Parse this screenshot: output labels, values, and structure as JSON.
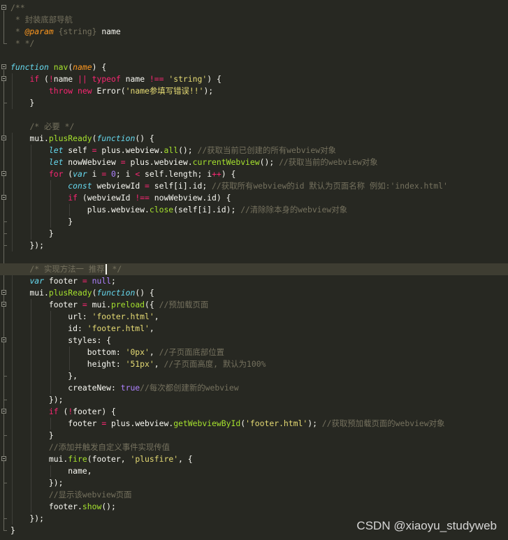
{
  "editor": {
    "theme": "monokai",
    "colors": {
      "background": "#272822",
      "keyword": "#f92672",
      "storage": "#66d9ef",
      "function": "#a6e22e",
      "parameter": "#fd971f",
      "string": "#e6db74",
      "number": "#ae81ff",
      "comment": "#75715e",
      "text": "#f8f8f2"
    },
    "current_line": 23,
    "lines": [
      {
        "fold": true,
        "tokens": [
          [
            "cm",
            "/**"
          ]
        ]
      },
      {
        "tokens": [
          [
            "cm",
            " * 封装底部导航"
          ]
        ]
      },
      {
        "tokens": [
          [
            "cm",
            " * "
          ],
          [
            "pa",
            "@param"
          ],
          [
            "cm",
            " {string} "
          ],
          [
            "id",
            "name"
          ]
        ]
      },
      {
        "tokens": [
          [
            "cm",
            " * */"
          ]
        ]
      },
      {
        "tokens": []
      },
      {
        "fold": true,
        "tokens": [
          [
            "st",
            "function"
          ],
          [
            "id",
            " "
          ],
          [
            "fn",
            "nav"
          ],
          [
            "id",
            "("
          ],
          [
            "pa",
            "name"
          ],
          [
            "id",
            ") {"
          ]
        ]
      },
      {
        "fold": true,
        "tokens": [
          [
            "id",
            "    "
          ],
          [
            "kw",
            "if"
          ],
          [
            "id",
            " ("
          ],
          [
            "op",
            "!"
          ],
          [
            "id",
            "name "
          ],
          [
            "op",
            "||"
          ],
          [
            "id",
            " "
          ],
          [
            "kw",
            "typeof"
          ],
          [
            "id",
            " name "
          ],
          [
            "op",
            "!=="
          ],
          [
            "id",
            " "
          ],
          [
            "str",
            "'string'"
          ],
          [
            "id",
            ") {"
          ]
        ]
      },
      {
        "tokens": [
          [
            "id",
            "        "
          ],
          [
            "kw",
            "throw"
          ],
          [
            "id",
            " "
          ],
          [
            "kw",
            "new"
          ],
          [
            "id",
            " Error("
          ],
          [
            "str",
            "'name参填写错误!!'"
          ],
          [
            "id",
            ");"
          ]
        ]
      },
      {
        "tokens": [
          [
            "id",
            "    }"
          ]
        ]
      },
      {
        "tokens": []
      },
      {
        "tokens": [
          [
            "id",
            "    "
          ],
          [
            "cm",
            "/* 必要 */"
          ]
        ]
      },
      {
        "fold": true,
        "tokens": [
          [
            "id",
            "    mui."
          ],
          [
            "fn",
            "plusReady"
          ],
          [
            "id",
            "("
          ],
          [
            "st",
            "function"
          ],
          [
            "id",
            "() {"
          ]
        ]
      },
      {
        "tokens": [
          [
            "id",
            "        "
          ],
          [
            "st",
            "let"
          ],
          [
            "id",
            " self "
          ],
          [
            "op",
            "="
          ],
          [
            "id",
            " plus.webview."
          ],
          [
            "fn",
            "all"
          ],
          [
            "id",
            "(); "
          ],
          [
            "cm",
            "//获取当前已创建的所有webview对象"
          ]
        ]
      },
      {
        "tokens": [
          [
            "id",
            "        "
          ],
          [
            "st",
            "let"
          ],
          [
            "id",
            " nowWebview "
          ],
          [
            "op",
            "="
          ],
          [
            "id",
            " plus.webview."
          ],
          [
            "fn",
            "currentWebview"
          ],
          [
            "id",
            "(); "
          ],
          [
            "cm",
            "//获取当前的webview对象"
          ]
        ]
      },
      {
        "fold": true,
        "tokens": [
          [
            "id",
            "        "
          ],
          [
            "kw",
            "for"
          ],
          [
            "id",
            " ("
          ],
          [
            "st",
            "var"
          ],
          [
            "id",
            " i "
          ],
          [
            "op",
            "="
          ],
          [
            "id",
            " "
          ],
          [
            "num",
            "0"
          ],
          [
            "id",
            "; i "
          ],
          [
            "op",
            "<"
          ],
          [
            "id",
            " self.length; i"
          ],
          [
            "op",
            "++"
          ],
          [
            "id",
            ") {"
          ]
        ]
      },
      {
        "tokens": [
          [
            "id",
            "            "
          ],
          [
            "st",
            "const"
          ],
          [
            "id",
            " webviewId "
          ],
          [
            "op",
            "="
          ],
          [
            "id",
            " self[i].id; "
          ],
          [
            "cm",
            "//获取所有webview的id 默认为页面名称 例如:'index.html'"
          ]
        ]
      },
      {
        "fold": true,
        "tokens": [
          [
            "id",
            "            "
          ],
          [
            "kw",
            "if"
          ],
          [
            "id",
            " (webviewId "
          ],
          [
            "op",
            "!=="
          ],
          [
            "id",
            " nowWebview.id) {"
          ]
        ]
      },
      {
        "tokens": [
          [
            "id",
            "                plus.webview."
          ],
          [
            "fn",
            "close"
          ],
          [
            "id",
            "(self[i].id); "
          ],
          [
            "cm",
            "//清除除本身的webview对象"
          ]
        ]
      },
      {
        "tokens": [
          [
            "id",
            "            }"
          ]
        ]
      },
      {
        "tokens": [
          [
            "id",
            "        }"
          ]
        ]
      },
      {
        "tokens": [
          [
            "id",
            "    });"
          ]
        ]
      },
      {
        "tokens": []
      },
      {
        "cursor_after": 3,
        "tokens": [
          [
            "cm",
            "    /* 实现方法一 推荐"
          ],
          [
            "cm",
            " */"
          ]
        ]
      },
      {
        "tokens": [
          [
            "id",
            "    "
          ],
          [
            "st",
            "var"
          ],
          [
            "id",
            " footer "
          ],
          [
            "op",
            "="
          ],
          [
            "id",
            " "
          ],
          [
            "num",
            "null"
          ],
          [
            "id",
            ";"
          ]
        ]
      },
      {
        "fold": true,
        "tokens": [
          [
            "id",
            "    mui."
          ],
          [
            "fn",
            "plusReady"
          ],
          [
            "id",
            "("
          ],
          [
            "st",
            "function"
          ],
          [
            "id",
            "() {"
          ]
        ]
      },
      {
        "fold": true,
        "tokens": [
          [
            "id",
            "        footer "
          ],
          [
            "op",
            "="
          ],
          [
            "id",
            " mui."
          ],
          [
            "fn",
            "preload"
          ],
          [
            "id",
            "({ "
          ],
          [
            "cm",
            "//预加载页面"
          ]
        ]
      },
      {
        "tokens": [
          [
            "id",
            "            url: "
          ],
          [
            "str",
            "'footer.html'"
          ],
          [
            "id",
            ","
          ]
        ]
      },
      {
        "tokens": [
          [
            "id",
            "            id: "
          ],
          [
            "str",
            "'footer.html'"
          ],
          [
            "id",
            ","
          ]
        ]
      },
      {
        "fold": true,
        "tokens": [
          [
            "id",
            "            styles: {"
          ]
        ]
      },
      {
        "tokens": [
          [
            "id",
            "                bottom: "
          ],
          [
            "str",
            "'0px'"
          ],
          [
            "id",
            ", "
          ],
          [
            "cm",
            "//子页面底部位置"
          ]
        ]
      },
      {
        "tokens": [
          [
            "id",
            "                height: "
          ],
          [
            "str",
            "'51px'"
          ],
          [
            "id",
            ", "
          ],
          [
            "cm",
            "//子页面高度, 默认为100%"
          ]
        ]
      },
      {
        "tokens": [
          [
            "id",
            "            },"
          ]
        ]
      },
      {
        "tokens": [
          [
            "id",
            "            createNew: "
          ],
          [
            "num",
            "true"
          ],
          [
            "cm",
            "//每次都创建新的webview"
          ]
        ]
      },
      {
        "tokens": [
          [
            "id",
            "        });"
          ]
        ]
      },
      {
        "fold": true,
        "tokens": [
          [
            "id",
            "        "
          ],
          [
            "kw",
            "if"
          ],
          [
            "id",
            " ("
          ],
          [
            "op",
            "!"
          ],
          [
            "id",
            "footer) {"
          ]
        ]
      },
      {
        "tokens": [
          [
            "id",
            "            footer "
          ],
          [
            "op",
            "="
          ],
          [
            "id",
            " plus.webview."
          ],
          [
            "fn",
            "getWebviewById"
          ],
          [
            "id",
            "("
          ],
          [
            "str",
            "'footer.html'"
          ],
          [
            "id",
            "); "
          ],
          [
            "cm",
            "//获取预加载页面的webview对象"
          ]
        ]
      },
      {
        "tokens": [
          [
            "id",
            "        }"
          ]
        ]
      },
      {
        "tokens": [
          [
            "id",
            "        "
          ],
          [
            "cm",
            "//添加并触发自定义事件实现传值"
          ]
        ]
      },
      {
        "fold": true,
        "tokens": [
          [
            "id",
            "        mui."
          ],
          [
            "fn",
            "fire"
          ],
          [
            "id",
            "(footer, "
          ],
          [
            "str",
            "'plusfire'"
          ],
          [
            "id",
            ", {"
          ]
        ]
      },
      {
        "tokens": [
          [
            "id",
            "            name,"
          ]
        ]
      },
      {
        "tokens": [
          [
            "id",
            "        });"
          ]
        ]
      },
      {
        "tokens": [
          [
            "id",
            "        "
          ],
          [
            "cm",
            "//显示该webview页面"
          ]
        ]
      },
      {
        "tokens": [
          [
            "id",
            "        footer."
          ],
          [
            "fn",
            "show"
          ],
          [
            "id",
            "();"
          ]
        ]
      },
      {
        "tokens": [
          [
            "id",
            "    });"
          ]
        ]
      },
      {
        "tokens": [
          [
            "id",
            "}"
          ]
        ]
      }
    ]
  },
  "watermark": {
    "text": "CSDN @xiaoyu_studyweb"
  }
}
